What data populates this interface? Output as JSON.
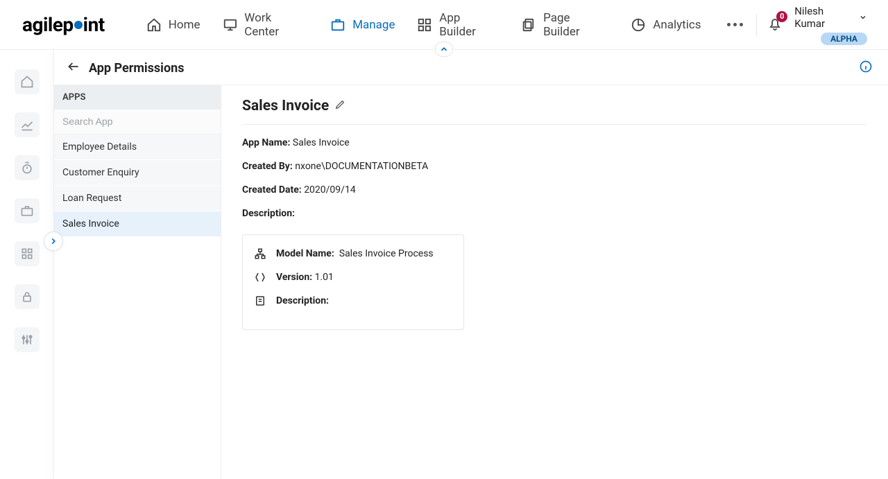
{
  "brand": "agilepoint",
  "nav": {
    "home": "Home",
    "work_center": "Work Center",
    "manage": "Manage",
    "app_builder": "App Builder",
    "page_builder": "Page Builder",
    "analytics": "Analytics"
  },
  "notif_count": "0",
  "user_name": "Nilesh Kumar",
  "alpha_badge": "ALPHA",
  "page": {
    "title": "App Permissions",
    "apps_heading": "APPS",
    "search_placeholder": "Search App",
    "apps": {
      "0": {
        "label": "Employee Details"
      },
      "1": {
        "label": "Customer Enquiry"
      },
      "2": {
        "label": "Loan Request"
      },
      "3": {
        "label": "Sales Invoice"
      }
    }
  },
  "detail": {
    "title": "Sales Invoice",
    "app_name_label": "App Name:",
    "app_name_value": "Sales Invoice",
    "created_by_label": "Created By:",
    "created_by_value": "nxone\\DOCUMENTATIONBETA",
    "created_date_label": "Created Date:",
    "created_date_value": "2020/09/14",
    "description_label": "Description:",
    "model_name_label": "Model Name:",
    "model_name_value": "Sales Invoice Process",
    "version_label": "Version:",
    "version_value": "1.01",
    "model_description_label": "Description:"
  }
}
